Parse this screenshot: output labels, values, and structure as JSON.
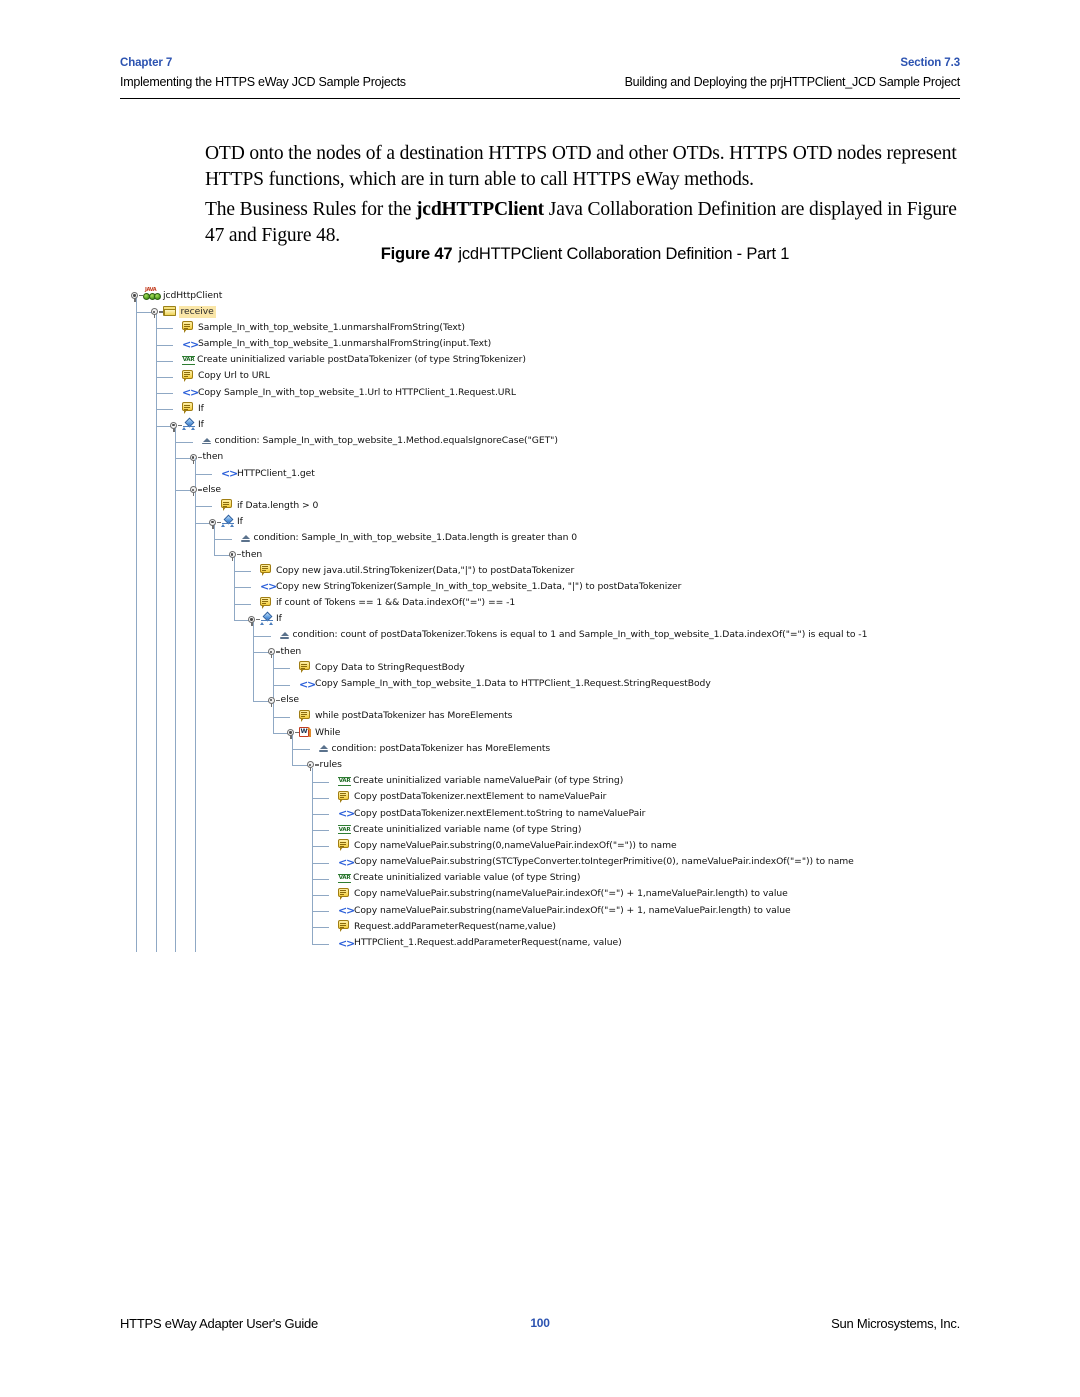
{
  "header": {
    "chapter_label": "Chapter 7",
    "chapter_subtitle": "Implementing the HTTPS eWay JCD Sample Projects",
    "section_label": "Section 7.3",
    "section_subtitle": "Building and Deploying the prjHTTPClient_JCD Sample Project"
  },
  "body": {
    "paragraph_1": "OTD onto the nodes of a destination HTTPS OTD and other OTDs. HTTPS OTD nodes represent HTTPS functions, which are in turn able to call HTTPS eWay methods.",
    "paragraph_2_part1": "The Business Rules for the ",
    "paragraph_2_bold": "jcdHTTPClient",
    "paragraph_2_part2": " Java Collaboration Definition are displayed in Figure 47 and Figure 48."
  },
  "figure": {
    "label": "Figure 47",
    "title": "jcdHTTPClient Collaboration Definition - Part 1"
  },
  "tree": {
    "rows": [
      {
        "label": "jcdHttpClient",
        "icon": "java-collaboration-icon",
        "depth": 0,
        "handle": true,
        "highlight": false
      },
      {
        "label": "receive",
        "icon": "folder-icon",
        "depth": 1,
        "handle": true,
        "highlight": true
      },
      {
        "label": "Sample_In_with_top_website_1.unmarshalFromString(Text)",
        "icon": "business-rule-icon",
        "depth": 2,
        "handle": false,
        "highlight": false
      },
      {
        "label": "Sample_In_with_top_website_1.unmarshalFromString(input.Text)",
        "icon": "code-icon",
        "depth": 2,
        "handle": false,
        "highlight": false
      },
      {
        "label": "Create uninitialized variable postDataTokenizer (of type StringTokenizer)",
        "icon": "variable-icon",
        "depth": 2,
        "handle": false,
        "highlight": false
      },
      {
        "label": "Copy Url to URL",
        "icon": "business-rule-icon",
        "depth": 2,
        "handle": false,
        "highlight": false
      },
      {
        "label": "Copy Sample_In_with_top_website_1.Url to HTTPClient_1.Request.URL",
        "icon": "code-icon",
        "depth": 2,
        "handle": false,
        "highlight": false
      },
      {
        "label": "If",
        "icon": "business-rule-icon",
        "depth": 2,
        "handle": false,
        "highlight": false
      },
      {
        "label": "If",
        "icon": "decision-icon",
        "depth": 2,
        "handle": true,
        "highlight": false
      },
      {
        "label": "condition: Sample_In_with_top_website_1.Method.equalsIgnoreCase(\"GET\")",
        "icon": "condition-icon",
        "depth": 3,
        "handle": false,
        "highlight": false
      },
      {
        "label": "then",
        "icon": "none",
        "depth": 3,
        "handle": true,
        "highlight": false
      },
      {
        "label": "HTTPClient_1.get",
        "icon": "code-icon",
        "depth": 4,
        "handle": false,
        "highlight": false,
        "last": true
      },
      {
        "label": "else",
        "icon": "none",
        "depth": 3,
        "handle": true,
        "highlight": false
      },
      {
        "label": "if Data.length > 0",
        "icon": "business-rule-icon",
        "depth": 4,
        "handle": false,
        "highlight": false
      },
      {
        "label": "If",
        "icon": "decision-icon",
        "depth": 4,
        "handle": true,
        "highlight": false
      },
      {
        "label": "condition: Sample_In_with_top_website_1.Data.length is greater than 0",
        "icon": "condition-icon",
        "depth": 5,
        "handle": false,
        "highlight": false
      },
      {
        "label": "then",
        "icon": "none",
        "depth": 5,
        "handle": true,
        "highlight": false
      },
      {
        "label": "Copy new java.util.StringTokenizer(Data,\"|\") to postDataTokenizer",
        "icon": "business-rule-icon",
        "depth": 6,
        "handle": false,
        "highlight": false
      },
      {
        "label": "Copy new StringTokenizer(Sample_In_with_top_website_1.Data, \"|\") to postDataTokenizer",
        "icon": "code-icon",
        "depth": 6,
        "handle": false,
        "highlight": false
      },
      {
        "label": "if count of Tokens == 1 && Data.indexOf(\"=\") == -1",
        "icon": "business-rule-icon",
        "depth": 6,
        "handle": false,
        "highlight": false
      },
      {
        "label": "If",
        "icon": "decision-icon",
        "depth": 6,
        "handle": true,
        "highlight": false
      },
      {
        "label": "condition: count of postDataTokenizer.Tokens is equal to 1 and Sample_In_with_top_website_1.Data.indexOf(\"=\") is equal to -1",
        "icon": "condition-icon",
        "depth": 7,
        "handle": false,
        "highlight": false
      },
      {
        "label": "then",
        "icon": "none",
        "depth": 7,
        "handle": true,
        "highlight": false
      },
      {
        "label": "Copy Data to StringRequestBody",
        "icon": "business-rule-icon",
        "depth": 8,
        "handle": false,
        "highlight": false
      },
      {
        "label": "Copy Sample_In_with_top_website_1.Data to HTTPClient_1.Request.StringRequestBody",
        "icon": "code-icon",
        "depth": 8,
        "handle": false,
        "highlight": false,
        "last": true
      },
      {
        "label": "else",
        "icon": "none",
        "depth": 7,
        "handle": true,
        "highlight": false
      },
      {
        "label": "while postDataTokenizer has MoreElements",
        "icon": "business-rule-icon",
        "depth": 8,
        "handle": false,
        "highlight": false
      },
      {
        "label": "While",
        "icon": "while-icon",
        "depth": 8,
        "handle": true,
        "highlight": false
      },
      {
        "label": "condition: postDataTokenizer has MoreElements",
        "icon": "condition-icon",
        "depth": 9,
        "handle": false,
        "highlight": false
      },
      {
        "label": "rules",
        "icon": "none",
        "depth": 9,
        "handle": true,
        "highlight": false
      },
      {
        "label": "Create uninitialized variable nameValuePair (of type String)",
        "icon": "variable-icon",
        "depth": 10,
        "handle": false,
        "highlight": false
      },
      {
        "label": "Copy postDataTokenizer.nextElement to nameValuePair",
        "icon": "business-rule-icon",
        "depth": 10,
        "handle": false,
        "highlight": false
      },
      {
        "label": "Copy postDataTokenizer.nextElement.toString to nameValuePair",
        "icon": "code-icon",
        "depth": 10,
        "handle": false,
        "highlight": false
      },
      {
        "label": "Create uninitialized variable name (of type String)",
        "icon": "variable-icon",
        "depth": 10,
        "handle": false,
        "highlight": false
      },
      {
        "label": "Copy nameValuePair.substring(0,nameValuePair.indexOf(\"=\")) to name",
        "icon": "business-rule-icon",
        "depth": 10,
        "handle": false,
        "highlight": false
      },
      {
        "label": "Copy nameValuePair.substring(STCTypeConverter.toIntegerPrimitive(0), nameValuePair.indexOf(\"=\")) to name",
        "icon": "code-icon",
        "depth": 10,
        "handle": false,
        "highlight": false
      },
      {
        "label": "Create uninitialized variable value (of type String)",
        "icon": "variable-icon",
        "depth": 10,
        "handle": false,
        "highlight": false
      },
      {
        "label": "Copy nameValuePair.substring(nameValuePair.indexOf(\"=\") + 1,nameValuePair.length) to value",
        "icon": "business-rule-icon",
        "depth": 10,
        "handle": false,
        "highlight": false
      },
      {
        "label": "Copy nameValuePair.substring(nameValuePair.indexOf(\"=\") + 1, nameValuePair.length) to value",
        "icon": "code-icon",
        "depth": 10,
        "handle": false,
        "highlight": false
      },
      {
        "label": "Request.addParameterRequest(name,value)",
        "icon": "business-rule-icon",
        "depth": 10,
        "handle": false,
        "highlight": false
      },
      {
        "label": "HTTPClient_1.Request.addParameterRequest(name, value)",
        "icon": "code-icon",
        "depth": 10,
        "handle": false,
        "highlight": false,
        "last": true
      }
    ],
    "icon_glyphs": {
      "code": "<>",
      "variable": "VAR",
      "while": "W"
    }
  },
  "footer": {
    "guide_title": "HTTPS eWay Adapter User's Guide",
    "page_number": "100",
    "company": "Sun Microsystems, Inc."
  },
  "colors": {
    "accent_blue": "#2B52B0",
    "highlight": "#FAE6A8",
    "tree_line": "#8FA8C4"
  }
}
